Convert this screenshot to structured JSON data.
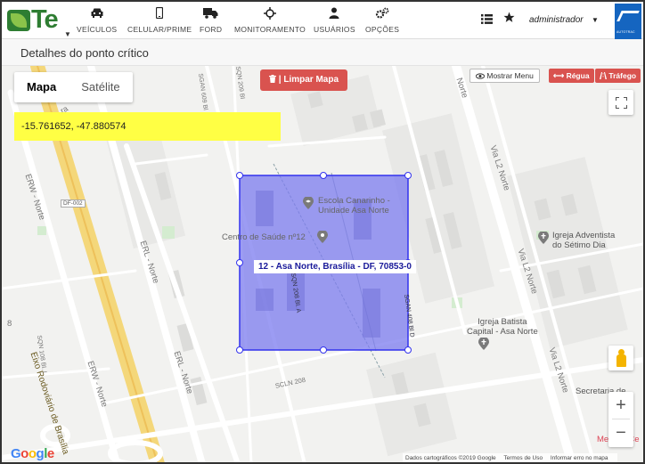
{
  "logo": {
    "text": "Te"
  },
  "nav": [
    {
      "label": "VEÍCULOS",
      "icon": "car-icon"
    },
    {
      "label": "CELULAR/PRIME",
      "icon": "phone-icon"
    },
    {
      "label": "FORD",
      "icon": "truck-icon"
    },
    {
      "label": "MONITORAMENTO",
      "icon": "crosshair-icon"
    },
    {
      "label": "USUÁRIOS",
      "icon": "user-icon"
    },
    {
      "label": "OPÇÕES",
      "icon": "gears-icon"
    }
  ],
  "user": {
    "name": "administrador"
  },
  "brand": {
    "text": "AUTOTRAC"
  },
  "page": {
    "title": "Detalhes do ponto crítico"
  },
  "map": {
    "tabs": [
      "Mapa",
      "Satélite"
    ],
    "active_tab": "Mapa",
    "coordinates": "-15.761652, -47.880574",
    "clear_button": "| Limpar Mapa",
    "show_menu_button": "Mostrar Menu",
    "ruler_button": "Régua",
    "traffic_button": "Tráfego",
    "address_label": "12 - Asa Norte, Brasília - DF, 70853-0",
    "pois": {
      "school": "Escola Canarinho -\nUnidade Asa Norte",
      "health": "Centro de Saúde nº12",
      "church_adventist": "Igreja Adventista\ndo Sétimo Dia",
      "church_baptist": "Igreja Batista\nCapital - Asa Norte",
      "secretaria": "Secretaria de",
      "medical": "Medical Ce"
    },
    "roads": {
      "eixo": "Eixo Rodoviário de Brasília",
      "erw_norte": "ERW - Norte",
      "erl_norte": "ERL - Norte",
      "via_l2": "Via L2 Norte",
      "df002": "DF-002",
      "sgan_609": "SGAN 609 Bl",
      "scln_208": "SCLN 208",
      "son_209": "SQN 209 Bl",
      "son_208a": "SQN 208 Bl. A",
      "sgan_408": "SGAN 408 Bl D",
      "sqn_108": "SQN 108 Bl. I",
      "norte": "Norte",
      "ra": "ra",
      "num8": "8"
    },
    "attribution": [
      "Dados cartográficos ©2019 Google",
      "Termos de Uso",
      "Informar erro no mapa"
    ],
    "google_letters": [
      "G",
      "o",
      "o",
      "g",
      "l",
      "e"
    ],
    "polygon_color": "#7b7bef"
  }
}
